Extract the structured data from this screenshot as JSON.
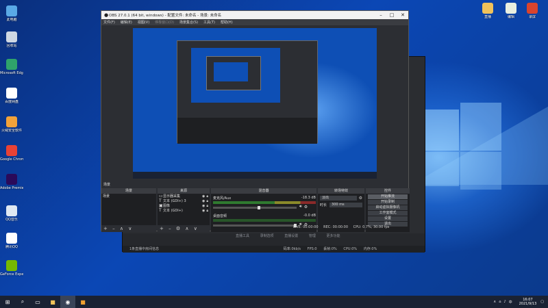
{
  "desktop": {
    "icons_left": [
      {
        "label": "此电脑",
        "color": "#5aa9e6"
      },
      {
        "label": "回收站",
        "color": "#cfd8e3"
      },
      {
        "label": "Microsoft Edge",
        "color": "#2fa36b"
      },
      {
        "label": "百度网盘",
        "color": "#ffffff"
      },
      {
        "label": "火绒安全软件",
        "color": "#f2a23a"
      },
      {
        "label": "Google Chrome",
        "color": "#e94235"
      },
      {
        "label": "Adobe Premiere",
        "color": "#2a0a5a"
      },
      {
        "label": "QQ音乐",
        "color": "#dfe8f2"
      },
      {
        "label": "腾讯QQ",
        "color": "#ffffff"
      },
      {
        "label": "GeForce Experience",
        "color": "#76b900"
      }
    ],
    "icons_right": [
      {
        "label": "直播",
        "color": "#f0c25a"
      },
      {
        "label": "编辑",
        "color": "#e8efe0"
      },
      {
        "label": "录屏",
        "color": "#d9442e"
      }
    ]
  },
  "obs": {
    "title": "OBS 27.0.1 (64 bit, windows) - 配置文件: 未命名 - 场景: 未命名",
    "menu": [
      "文件(F)",
      "编辑(E)",
      "视图(V)",
      "停靠窗口(D)",
      "场景集合(S)",
      "工具(T)",
      "帮助(H)"
    ],
    "scene_label": "场景",
    "docks": {
      "scenes": {
        "title": "场景",
        "items": [
          "场景"
        ]
      },
      "sources": {
        "title": "来源",
        "items": [
          "显示器采集",
          "文本 (GDI+) 3",
          "图像",
          "文本 (GDI+)"
        ]
      },
      "mixer": {
        "title": "混音器",
        "channels": [
          {
            "name": "麦克风/Aux",
            "db": "-18.3 dB",
            "level": 0.45
          },
          {
            "name": "桌面音频",
            "db": "-0.0 dB",
            "level": 0.0
          }
        ]
      },
      "transitions": {
        "title": "转场特效",
        "type": "淡出",
        "duration_label": "时长",
        "duration_value": "300 ms"
      },
      "controls": {
        "title": "控件",
        "buttons": [
          "开始推流",
          "开始录制",
          "启动虚拟摄像机",
          "工作室模式",
          "设置",
          "退出"
        ]
      }
    },
    "status": {
      "live": "LIVE: 00:00:00",
      "rec": "REC: 00:00:00",
      "cpu": "CPU: 0.7%, 30.00 fps"
    }
  },
  "bg_window": {
    "menu": [
      "直播工具",
      "录制选项",
      "直播设置",
      "管理",
      "更多功能"
    ],
    "status": "1条直播中房间信息",
    "stats": [
      "码率:0kb/s",
      "FPS:0",
      "丢帧:0%",
      "CPU:0%",
      "内存:0%"
    ]
  },
  "taskbar": {
    "time": "16:07",
    "date": "2021/9/13"
  }
}
